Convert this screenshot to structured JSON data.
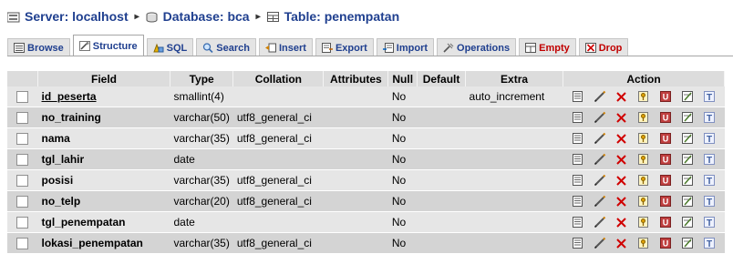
{
  "breadcrumb": {
    "server_label": "Server: localhost",
    "database_label": "Database: bca",
    "table_label": "Table: penempatan",
    "sep": "▸"
  },
  "tabs": [
    {
      "label": "Browse"
    },
    {
      "label": "Structure"
    },
    {
      "label": "SQL"
    },
    {
      "label": "Search"
    },
    {
      "label": "Insert"
    },
    {
      "label": "Export"
    },
    {
      "label": "Import"
    },
    {
      "label": "Operations"
    },
    {
      "label": "Empty"
    },
    {
      "label": "Drop"
    }
  ],
  "columns": {
    "field": "Field",
    "type": "Type",
    "collation": "Collation",
    "attributes": "Attributes",
    "null": "Null",
    "default": "Default",
    "extra": "Extra",
    "action": "Action"
  },
  "rows": [
    {
      "field": "id_peserta",
      "type": "smallint(4)",
      "collation": "",
      "attributes": "",
      "null": "No",
      "default": "",
      "extra": "auto_increment"
    },
    {
      "field": "no_training",
      "type": "varchar(50)",
      "collation": "utf8_general_ci",
      "attributes": "",
      "null": "No",
      "default": "",
      "extra": ""
    },
    {
      "field": "nama",
      "type": "varchar(35)",
      "collation": "utf8_general_ci",
      "attributes": "",
      "null": "No",
      "default": "",
      "extra": ""
    },
    {
      "field": "tgl_lahir",
      "type": "date",
      "collation": "",
      "attributes": "",
      "null": "No",
      "default": "",
      "extra": ""
    },
    {
      "field": "posisi",
      "type": "varchar(35)",
      "collation": "utf8_general_ci",
      "attributes": "",
      "null": "No",
      "default": "",
      "extra": ""
    },
    {
      "field": "no_telp",
      "type": "varchar(20)",
      "collation": "utf8_general_ci",
      "attributes": "",
      "null": "No",
      "default": "",
      "extra": ""
    },
    {
      "field": "tgl_penempatan",
      "type": "date",
      "collation": "",
      "attributes": "",
      "null": "No",
      "default": "",
      "extra": ""
    },
    {
      "field": "lokasi_penempatan",
      "type": "varchar(35)",
      "collation": "utf8_general_ci",
      "attributes": "",
      "null": "No",
      "default": "",
      "extra": ""
    }
  ],
  "action_icons": [
    "browse-distinct-icon",
    "edit-pencil-icon",
    "drop-x-icon",
    "primary-key-icon",
    "unique-icon",
    "index-icon",
    "fulltext-icon"
  ],
  "colors": {
    "link_blue": "#1f3f8f",
    "danger_red": "#c10000",
    "header_gray": "#dcdcdc",
    "row_light": "#e6e6e6",
    "row_dark": "#d4d4d4"
  }
}
